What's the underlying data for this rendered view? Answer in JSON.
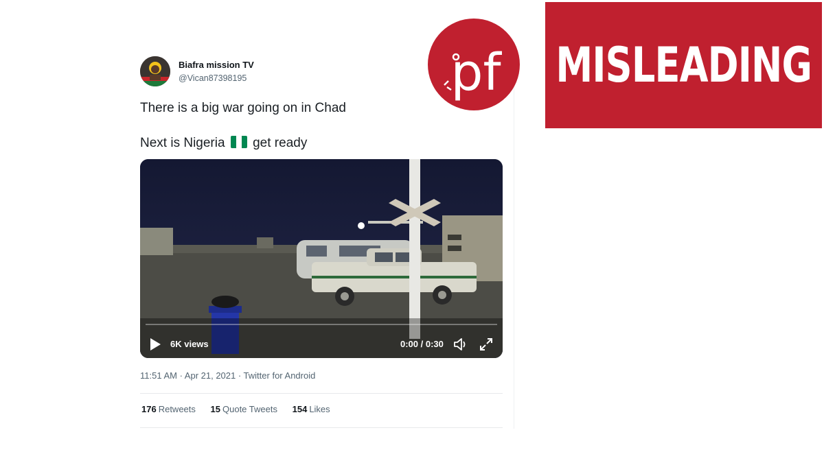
{
  "tweet": {
    "author_name": "Biafra mission TV",
    "author_handle": "@Vican87398195",
    "line1": "There is a big war going on in Chad",
    "line2_before_flag": "Next is Nigeria",
    "line2_after_flag": "get ready",
    "flag_icon": "nigeria-flag-emoji",
    "meta": "11:51 AM · Apr 21, 2021 · Twitter for Android",
    "video": {
      "views": "6K views",
      "time": "0:00 / 0:30"
    },
    "stats": [
      {
        "count": "176",
        "label": "Retweets"
      },
      {
        "count": "15",
        "label": "Quote Tweets"
      },
      {
        "count": "154",
        "label": "Likes"
      }
    ]
  },
  "brand": {
    "logo_text": "pf",
    "logo_color": "#c0202f",
    "verdict": "MISLEADING",
    "verdict_bg": "#c0202f"
  },
  "colors": {
    "secondary_text": "#536471",
    "primary_text": "#0f1419",
    "nigeria_green": "#008751"
  }
}
